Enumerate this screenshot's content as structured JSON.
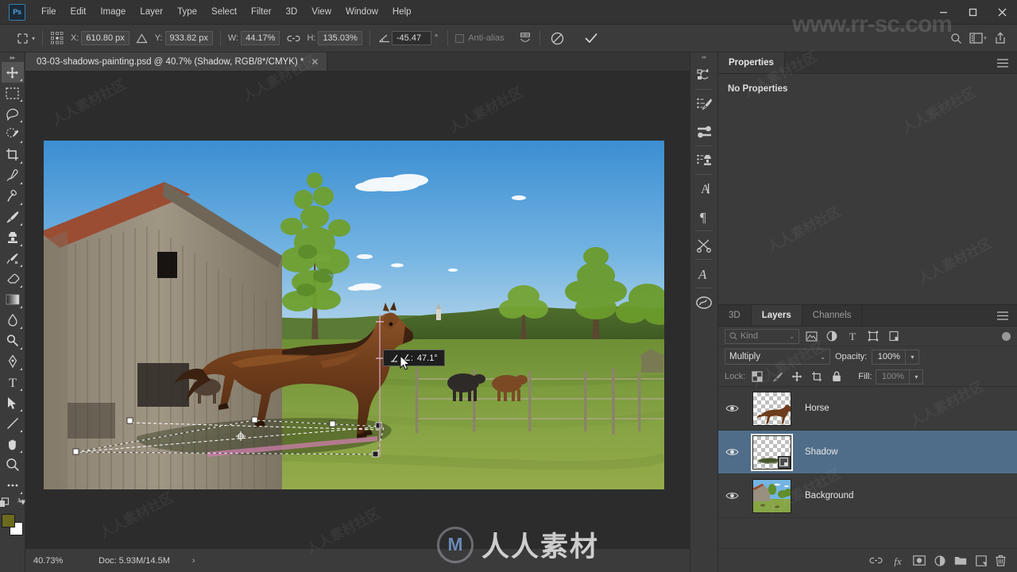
{
  "app": {
    "logo": "Ps",
    "watermark_url": "www.rr-sc.com",
    "watermark_cn": "人人素材",
    "watermark_cn_tile": "人人素材社区",
    "logo_mark": "M"
  },
  "menubar": {
    "items": [
      {
        "label": "File",
        "name": "menu-file"
      },
      {
        "label": "Edit",
        "name": "menu-edit"
      },
      {
        "label": "Image",
        "name": "menu-image"
      },
      {
        "label": "Layer",
        "name": "menu-layer"
      },
      {
        "label": "Type",
        "name": "menu-type"
      },
      {
        "label": "Select",
        "name": "menu-select"
      },
      {
        "label": "Filter",
        "name": "menu-filter"
      },
      {
        "label": "3D",
        "name": "menu-3d"
      },
      {
        "label": "View",
        "name": "menu-view"
      },
      {
        "label": "Window",
        "name": "menu-window"
      },
      {
        "label": "Help",
        "name": "menu-help"
      }
    ],
    "window_controls": {
      "minimize": "—",
      "maximize": "❐",
      "close": "✕"
    }
  },
  "options_bar": {
    "x_label": "X:",
    "x_value": "610.80 px",
    "y_label": "Y:",
    "y_value": "933.82 px",
    "w_label": "W:",
    "w_value": "44.17%",
    "h_label": "H:",
    "h_value": "135.03%",
    "angle_value": "-45.47",
    "angle_unit": "°",
    "antialias_label": "Anti-alias",
    "icons": {
      "reference_point": "reference-point-icon",
      "link_wh": "link-icon",
      "angle": "angle-icon",
      "skew": "skew-icon",
      "warp": "warp-icon",
      "cancel": "cancel-transform-icon",
      "commit": "commit-transform-icon",
      "search": "search-icon",
      "workspace": "workspace-icon",
      "share": "share-icon"
    }
  },
  "toolbar": {
    "tools": [
      {
        "name": "move-tool",
        "glyph": "move"
      },
      {
        "name": "rectangular-marquee-tool",
        "glyph": "marquee"
      },
      {
        "name": "lasso-tool",
        "glyph": "lasso"
      },
      {
        "name": "quick-selection-tool",
        "glyph": "quickselect"
      },
      {
        "name": "crop-tool",
        "glyph": "crop"
      },
      {
        "name": "eyedropper-tool",
        "glyph": "eyedropper"
      },
      {
        "name": "spot-healing-brush-tool",
        "glyph": "healing"
      },
      {
        "name": "brush-tool",
        "glyph": "brush"
      },
      {
        "name": "clone-stamp-tool",
        "glyph": "stamp"
      },
      {
        "name": "history-brush-tool",
        "glyph": "historybrush"
      },
      {
        "name": "eraser-tool",
        "glyph": "eraser"
      },
      {
        "name": "gradient-tool",
        "glyph": "gradient"
      },
      {
        "name": "blur-tool",
        "glyph": "blur"
      },
      {
        "name": "dodge-tool",
        "glyph": "dodge"
      },
      {
        "name": "pen-tool",
        "glyph": "pen"
      },
      {
        "name": "horizontal-type-tool",
        "glyph": "type"
      },
      {
        "name": "path-selection-tool",
        "glyph": "pathselect"
      },
      {
        "name": "line-tool",
        "glyph": "line"
      },
      {
        "name": "hand-tool",
        "glyph": "hand"
      },
      {
        "name": "zoom-tool",
        "glyph": "zoom"
      },
      {
        "name": "edit-toolbar-button",
        "glyph": "ellipsis"
      }
    ],
    "foreground_color": "#6b6b1e",
    "background_color": "#ffffff"
  },
  "document": {
    "tab_title": "03-03-shadows-painting.psd @ 40.7% (Shadow, RGB/8*/CMYK) *",
    "close_glyph": "✕"
  },
  "canvas": {
    "transform_tooltip_label": "∠:",
    "transform_tooltip_value": "47.1°"
  },
  "status_bar": {
    "zoom": "40.73%",
    "doc_info": "Doc: 5.93M/14.5M",
    "arrow": "›"
  },
  "icon_dock": {
    "icons": [
      {
        "name": "history-panel-icon"
      },
      {
        "name": "brush-settings-icon"
      },
      {
        "name": "brush-presets-icon"
      },
      {
        "name": "clone-source-icon"
      },
      {
        "name": "character-panel-icon"
      },
      {
        "name": "paragraph-panel-icon"
      },
      {
        "name": "adjustments-icon"
      },
      {
        "name": "glyphs-panel-icon"
      },
      {
        "name": "creative-cloud-libraries-icon"
      }
    ]
  },
  "properties_panel": {
    "tabs": [
      {
        "label": "Properties",
        "active": true,
        "name": "tab-properties"
      }
    ],
    "empty_message": "No Properties",
    "menu_glyph": "☰"
  },
  "layers_panel": {
    "tabs": [
      {
        "label": "3D",
        "active": false,
        "name": "tab-3d"
      },
      {
        "label": "Layers",
        "active": true,
        "name": "tab-layers"
      },
      {
        "label": "Channels",
        "active": false,
        "name": "tab-channels"
      }
    ],
    "menu_glyph": "☰",
    "filter": {
      "kind_label": "Kind",
      "chevron": "⌄",
      "filter_icons": [
        {
          "name": "filter-pixel-icon"
        },
        {
          "name": "filter-adjustment-icon"
        },
        {
          "name": "filter-type-icon"
        },
        {
          "name": "filter-shape-icon"
        },
        {
          "name": "filter-smartobject-icon"
        }
      ]
    },
    "blend_mode": "Multiply",
    "blend_chevron": "⌄",
    "opacity_label": "Opacity:",
    "opacity_value": "100%",
    "lock_label": "Lock:",
    "fill_label": "Fill:",
    "fill_value": "100%",
    "lock_icons": [
      {
        "name": "lock-transparent-pixels-icon"
      },
      {
        "name": "lock-image-pixels-icon"
      },
      {
        "name": "lock-position-icon"
      },
      {
        "name": "lock-artboard-nesting-icon"
      },
      {
        "name": "lock-all-icon"
      }
    ],
    "layers": [
      {
        "name": "Horse",
        "visible": true,
        "selected": false,
        "kind": "transparent",
        "badge": null
      },
      {
        "name": "Shadow",
        "visible": true,
        "selected": true,
        "kind": "transparent",
        "badge": "smart-object-badge"
      },
      {
        "name": "Background",
        "visible": true,
        "selected": false,
        "kind": "image",
        "badge": null
      }
    ],
    "footer_icons": [
      {
        "name": "link-layers-icon"
      },
      {
        "name": "layer-styles-icon",
        "label": "fx"
      },
      {
        "name": "add-layer-mask-icon"
      },
      {
        "name": "new-adjustment-layer-icon"
      },
      {
        "name": "new-group-icon"
      },
      {
        "name": "new-layer-icon"
      },
      {
        "name": "delete-layer-icon"
      }
    ]
  },
  "colors": {
    "chrome_bg": "#3b3b3b",
    "menu_bg": "#333333",
    "canvas_bg": "#2c2c2c",
    "selection_blue": "#4f6d89",
    "accent_blue": "#4ea3e0"
  }
}
